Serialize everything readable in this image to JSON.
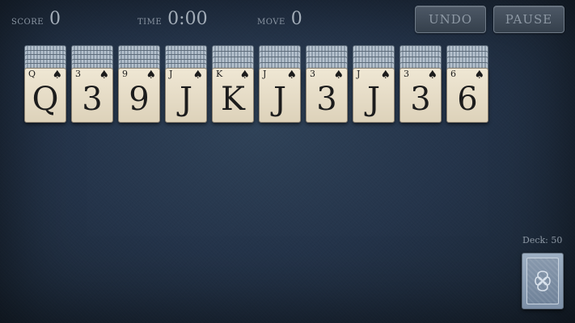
{
  "hud": {
    "score_label": "SCORE",
    "score_value": "0",
    "time_label": "TIME",
    "time_value": "0:00",
    "move_label": "MOVE",
    "move_value": "0",
    "undo_label": "UNDO",
    "pause_label": "PAUSE"
  },
  "tableau": [
    {
      "rank": "Q",
      "suit": "♠",
      "hidden_cards": 5
    },
    {
      "rank": "3",
      "suit": "♠",
      "hidden_cards": 5
    },
    {
      "rank": "9",
      "suit": "♠",
      "hidden_cards": 5
    },
    {
      "rank": "J",
      "suit": "♠",
      "hidden_cards": 5
    },
    {
      "rank": "K",
      "suit": "♠",
      "hidden_cards": 4
    },
    {
      "rank": "J",
      "suit": "♠",
      "hidden_cards": 4
    },
    {
      "rank": "3",
      "suit": "♠",
      "hidden_cards": 4
    },
    {
      "rank": "J",
      "suit": "♠",
      "hidden_cards": 4
    },
    {
      "rank": "3",
      "suit": "♠",
      "hidden_cards": 4
    },
    {
      "rank": "6",
      "suit": "♠",
      "hidden_cards": 4
    }
  ],
  "deck": {
    "label": "Deck: 50",
    "icon": "celtic-knot-icon"
  },
  "colors": {
    "felt": "#24344a",
    "card_face": "#e8dfca",
    "card_back": "#8899ad"
  }
}
